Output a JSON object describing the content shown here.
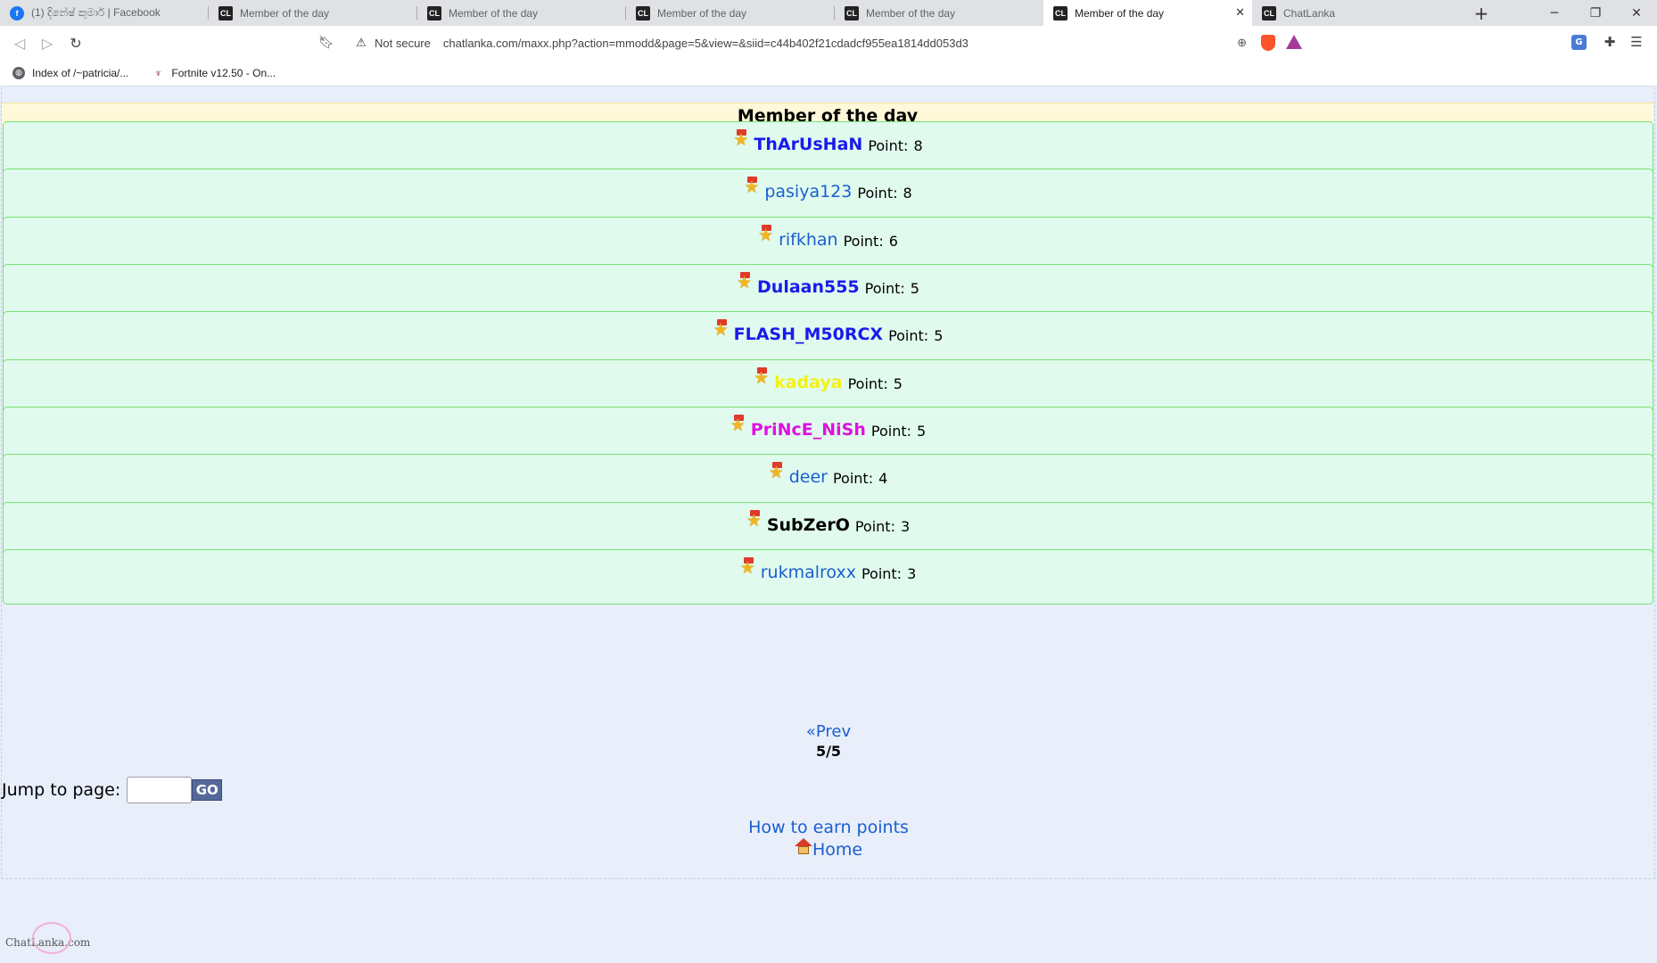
{
  "browser": {
    "tabs": [
      {
        "title": "(1) දිනේෂ් කුමාර් | Facebook",
        "favicon": "facebook-icon",
        "active": false
      },
      {
        "title": "Member of the day",
        "favicon": "chatlanka-icon",
        "active": false
      },
      {
        "title": "Member of the day",
        "favicon": "chatlanka-icon",
        "active": false
      },
      {
        "title": "Member of the day",
        "favicon": "chatlanka-icon",
        "active": false
      },
      {
        "title": "Member of the day",
        "favicon": "chatlanka-icon",
        "active": false
      },
      {
        "title": "Member of the day",
        "favicon": "chatlanka-icon",
        "active": true
      },
      {
        "title": "ChatLanka",
        "favicon": "chatlanka-icon",
        "active": false
      }
    ],
    "security_label": "Not secure",
    "url": "chatlanka.com/maxx.php?action=mmodd&page=5&view=&siid=c44b402f21cdadcf955ea1814dd053d3",
    "bookmarks": [
      {
        "label": "Index of /~patricia/...",
        "icon": "globe-icon"
      },
      {
        "label": "Fortnite v12.50 - On...",
        "icon": "fortnite-icon"
      }
    ]
  },
  "page": {
    "title": "Member of the day",
    "point_label": "Point:",
    "members": [
      {
        "name": "ThArUsHaN",
        "points": "8",
        "color": "#1a1aeb",
        "bold": true
      },
      {
        "name": "pasiya123",
        "points": "8",
        "color": "#1a5fd0",
        "bold": false
      },
      {
        "name": "rifkhan",
        "points": "6",
        "color": "#1a5fd0",
        "bold": false
      },
      {
        "name": "Dulaan555",
        "points": "5",
        "color": "#1a1aeb",
        "bold": true
      },
      {
        "name": "FLASH_M50RCX",
        "points": "5",
        "color": "#1a1aeb",
        "bold": true
      },
      {
        "name": "kadaya",
        "points": "5",
        "color": "#f5f016",
        "bold": true
      },
      {
        "name": "PriNcE_NiSh",
        "points": "5",
        "color": "#e010e0",
        "bold": true
      },
      {
        "name": "deer",
        "points": "4",
        "color": "#1a5fd0",
        "bold": false
      },
      {
        "name": "SubZerO",
        "points": "3",
        "color": "#000000",
        "bold": true
      },
      {
        "name": "rukmalroxx",
        "points": "3",
        "color": "#1a5fd0",
        "bold": false
      }
    ],
    "prev_label": "«Prev",
    "page_indicator": "5/5",
    "jump_label": "Jump to page:",
    "jump_value": "",
    "go_label": "GO",
    "earn_link": "How to earn points",
    "home_link": "Home",
    "logo_text": "ChatLanka.com"
  }
}
